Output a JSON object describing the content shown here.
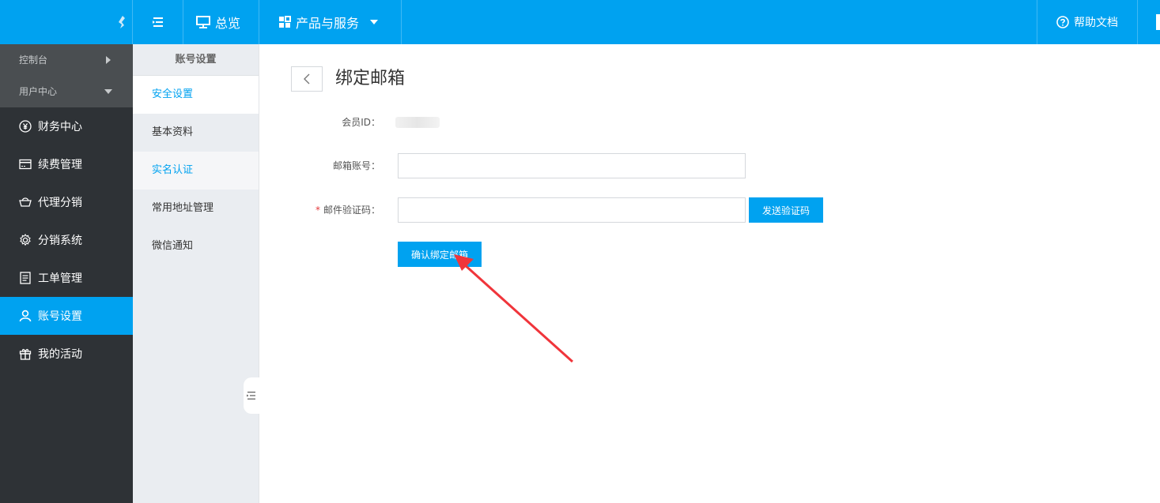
{
  "topbar": {
    "overview_label": "总览",
    "products_label": "产品与服务",
    "help_label": "帮助文档"
  },
  "sidebar": {
    "sections": [
      {
        "label": "控制台"
      },
      {
        "label": "用户中心"
      }
    ],
    "items": [
      {
        "label": "财务中心",
        "icon": "yen-circle-icon"
      },
      {
        "label": "续费管理",
        "icon": "card-icon"
      },
      {
        "label": "代理分销",
        "icon": "basket-icon"
      },
      {
        "label": "分销系统",
        "icon": "gear-icon"
      },
      {
        "label": "工单管理",
        "icon": "document-icon"
      },
      {
        "label": "账号设置",
        "icon": "user-icon",
        "active": true
      },
      {
        "label": "我的活动",
        "icon": "gift-icon"
      }
    ]
  },
  "subnav": {
    "title": "账号设置",
    "items": [
      {
        "label": "安全设置",
        "state": "current"
      },
      {
        "label": "基本资料"
      },
      {
        "label": "实名认证",
        "state": "hover"
      },
      {
        "label": "常用地址管理"
      },
      {
        "label": "微信通知"
      }
    ]
  },
  "page": {
    "title": "绑定邮箱",
    "member_id_label": "会员ID：",
    "email_label": "邮箱账号：",
    "email_value": "",
    "code_label": "邮件验证码：",
    "code_value": "",
    "send_code_button": "发送验证码",
    "confirm_button": "确认绑定邮箱"
  },
  "colors": {
    "accent": "#00a2f0",
    "sidebar_bg": "#2e3236",
    "annotation_arrow": "#f0353b"
  }
}
